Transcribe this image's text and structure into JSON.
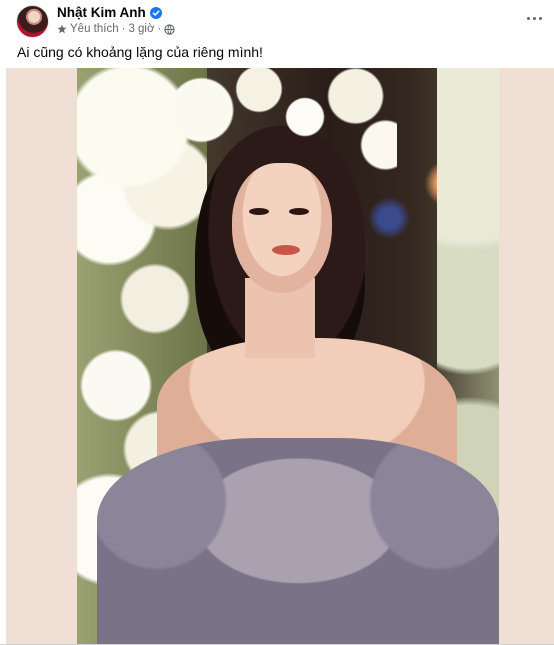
{
  "post": {
    "author": {
      "name": "Nhật Kim Anh",
      "verified": true
    },
    "meta": {
      "reaction_label": "Yêu thích",
      "separator": "·",
      "time": "3 giờ",
      "audience_icon": "globe-icon"
    },
    "caption": "Ai cũng có khoảng lặng của riêng mình!",
    "icons": {
      "verified": "verified-badge-icon",
      "favorite": "star-icon",
      "more": "more-options-icon"
    },
    "colors": {
      "verified_blue": "#1877f2",
      "meta_gray": "#65676b",
      "photo_backdrop": "#f0dfd5"
    }
  }
}
